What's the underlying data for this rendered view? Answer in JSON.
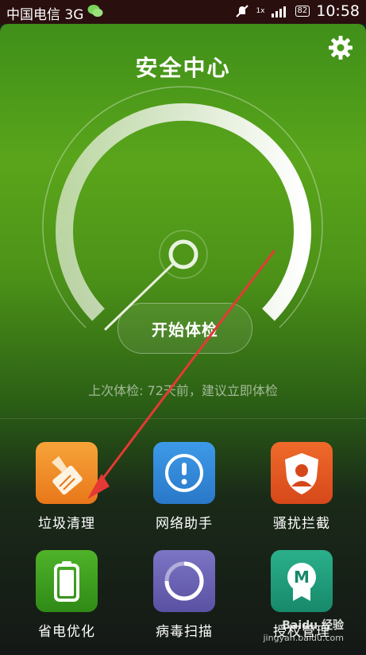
{
  "status_bar": {
    "carrier": "中国电信 3G",
    "signal_label": "1x",
    "battery": "82",
    "time": "10:58"
  },
  "app": {
    "title": "安全中心",
    "start_button": "开始体检",
    "last_check": "上次体检: 72天前，建议立即体检"
  },
  "tiles": [
    {
      "label": "垃圾清理",
      "icon": "broom-icon",
      "color": "#f08a1e"
    },
    {
      "label": "网络助手",
      "icon": "exclamation-icon",
      "color": "#2e87d8"
    },
    {
      "label": "骚扰拦截",
      "icon": "shield-user-icon",
      "color": "#e0561f"
    },
    {
      "label": "省电优化",
      "icon": "battery-icon",
      "color": "#3a9a1f"
    },
    {
      "label": "病毒扫描",
      "icon": "scan-icon",
      "color": "#6e65b8"
    },
    {
      "label": "授权管理",
      "icon": "badge-icon",
      "color": "#1e9a7a"
    }
  ],
  "watermark": {
    "brand": "Baidu 经验",
    "url": "jingyan.baidu.com"
  },
  "colors": {
    "accent_green": "#5aa51b",
    "arrow_red": "#e53935"
  }
}
